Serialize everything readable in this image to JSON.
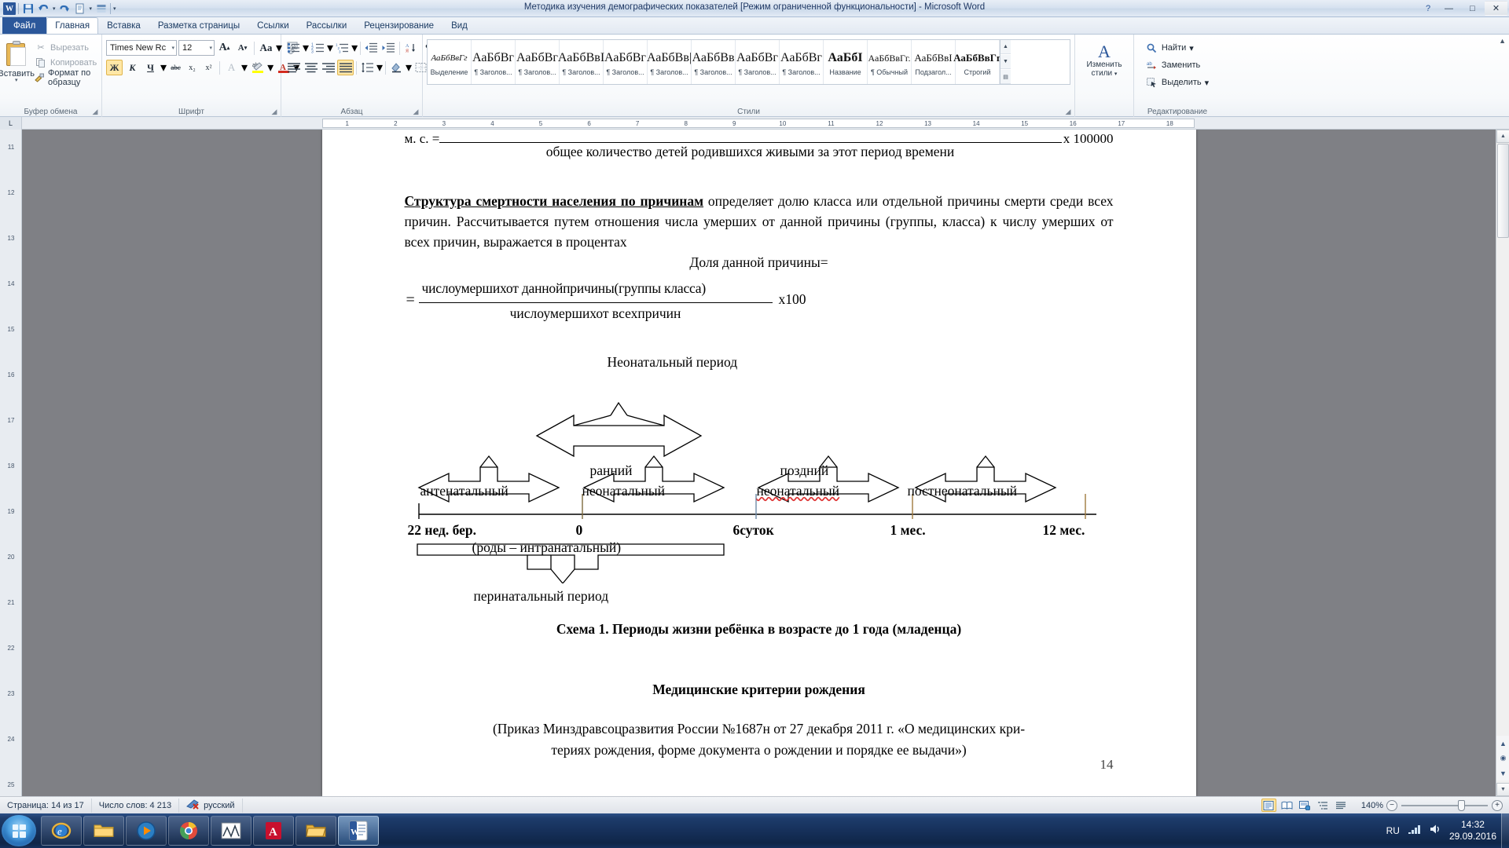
{
  "window": {
    "title": "Методика изучения демографических показателей [Режим ограниченной функциональности]  -  Microsoft Word",
    "minimize": "—",
    "maximize": "□",
    "close": "✕",
    "help": "?"
  },
  "quick_access": {
    "app_logo": "W",
    "save": "save-icon",
    "undo": "undo-icon",
    "redo": "redo-icon",
    "print_preview": "print-preview-icon",
    "customize": "customize-icon"
  },
  "tabs": [
    {
      "label": "Файл",
      "active": false,
      "kind": "file"
    },
    {
      "label": "Главная",
      "active": true
    },
    {
      "label": "Вставка",
      "active": false
    },
    {
      "label": "Разметка страницы",
      "active": false
    },
    {
      "label": "Ссылки",
      "active": false
    },
    {
      "label": "Рассылки",
      "active": false
    },
    {
      "label": "Рецензирование",
      "active": false
    },
    {
      "label": "Вид",
      "active": false
    }
  ],
  "ribbon": {
    "clipboard": {
      "group_label": "Буфер обмена",
      "paste": "Вставить",
      "cut": "Вырезать",
      "copy": "Копировать",
      "format_painter": "Формат по образцу"
    },
    "font": {
      "group_label": "Шрифт",
      "font_name": "Times New Rc",
      "font_size": "12",
      "grow_font": "A",
      "shrink_font": "A",
      "change_case": "Aa",
      "clear_formatting": "Aa",
      "bold": "Ж",
      "italic": "К",
      "underline": "Ч",
      "strikethrough": "abc",
      "subscript": "x₂",
      "superscript": "x²",
      "text_effects": "A",
      "highlight": "ab",
      "font_color": "A"
    },
    "paragraph": {
      "group_label": "Абзац",
      "bullets": "bullet-list-icon",
      "numbering": "numbered-list-icon",
      "multilevel": "multilevel-list-icon",
      "decrease_indent": "decrease-indent-icon",
      "increase_indent": "increase-indent-icon",
      "sort": "sort-icon",
      "show_marks": "¶",
      "align_left": "align-left-icon",
      "align_center": "align-center-icon",
      "align_right": "align-right-icon",
      "justify": "justify-icon",
      "line_spacing": "line-spacing-icon",
      "shading": "shading-icon",
      "borders": "borders-icon"
    },
    "styles": {
      "group_label": "Стили",
      "items": [
        {
          "sample": "АаБбВвГг",
          "name": "Выделение",
          "style": "ital"
        },
        {
          "sample": "АаБбВг",
          "name": "¶ Заголов...",
          "style": "bold"
        },
        {
          "sample": "АаБбВг",
          "name": "¶ Заголов...",
          "style": "bold"
        },
        {
          "sample": "АаБбВвI",
          "name": "¶ Заголов...",
          "style": "norm"
        },
        {
          "sample": "АаБбВг",
          "name": "¶ Заголов...",
          "style": "norm"
        },
        {
          "sample": "АаБбВв|",
          "name": "¶ Заголов...",
          "style": "norm"
        },
        {
          "sample": "АаБбВв",
          "name": "¶ Заголов...",
          "style": "norm"
        },
        {
          "sample": "АаБбВг",
          "name": "¶ Заголов...",
          "style": "norm"
        },
        {
          "sample": "АаБбВг",
          "name": "¶ Заголов...",
          "style": "norm"
        },
        {
          "sample": "АаБбІ",
          "name": "Название",
          "style": "bold"
        },
        {
          "sample": "АаБбВвГг.",
          "name": "¶ Обычный",
          "style": "norm"
        },
        {
          "sample": "АаБбВвI",
          "name": "Подзагол...",
          "style": "norm"
        },
        {
          "sample": "АаБбВвГг",
          "name": "Строгий",
          "style": "bold"
        }
      ],
      "scroll_up": "▲",
      "scroll_down": "▼",
      "more": "▤"
    },
    "change_styles": {
      "glyph": "A",
      "label": "Изменить\nстили"
    },
    "editing": {
      "group_label": "Редактирование",
      "find": "Найти",
      "replace": "Заменить",
      "select": "Выделить"
    }
  },
  "ruler": {
    "corner_tab": "L",
    "h_ticks": [
      "1",
      "2",
      "3",
      "4",
      "5",
      "6",
      "7",
      "8",
      "9",
      "10",
      "11",
      "12",
      "13",
      "14",
      "15",
      "16",
      "17",
      "18"
    ],
    "v_ticks": [
      "11",
      "12",
      "13",
      "14",
      "15",
      "16",
      "17",
      "18",
      "19",
      "20",
      "21",
      "22",
      "23",
      "24",
      "25"
    ]
  },
  "document": {
    "top_formula": {
      "lhs": "м. с. =",
      "denominator": "общее количество детей родившихся  живыми за этот период времени",
      "multiplier": "х 100000"
    },
    "paragraph": {
      "bold_lead": "Структура смертности населения по причинам",
      "rest": " определяет долю класса или отдельной причины смерти среди всех причин. Рассчитывается путем отношения числа умерших от данной причины (группы, класса) к числу умерших от всех причин, выражается в процентах"
    },
    "fraction_title": "Доля данной причины=",
    "fraction": {
      "equals": "=",
      "numerator": "числоумершихот даннойпричины(группы класса)",
      "denominator": "числоумершихот всехпричин",
      "multiplier": "х100"
    },
    "schema": {
      "neonatal_title": "Неонатальный период",
      "early": "ранний",
      "late": "поздний",
      "period_labels": [
        "антенатальный",
        "неонатальный",
        "неонатальный",
        "постнеонатальный"
      ],
      "axis_labels": [
        "22 нед. бер.",
        "0",
        "6суток",
        "1 мес.",
        "12 мес."
      ],
      "intranatal": "(роды – интранатальный)",
      "perinatal": "перинатальный период",
      "caption": "Схема 1.  Периоды жизни ребёнка в возрасте до 1 года (младенца)"
    },
    "heading": "Медицинские критерии рождения",
    "order_text_line1": "(Приказ Минздравсоцразвития России №1687н от 27 декабря 2011 г. «О медицинских кри-",
    "order_text_line2": "териях рождения, форме документа о рождении и порядке ее выдачи»)",
    "page_number": "14"
  },
  "status_bar": {
    "page": "Страница: 14 из 17",
    "words": "Число слов: 4 213",
    "proofing_icon": "proofing-errors-icon",
    "language": "русский",
    "views": {
      "print_layout": "print-layout-icon",
      "full_screen": "full-screen-reading-icon",
      "web_layout": "web-layout-icon",
      "outline": "outline-icon",
      "draft": "draft-icon"
    },
    "zoom": "140%",
    "zoom_out": "−",
    "zoom_in": "+"
  },
  "taskbar": {
    "start": "start-orb",
    "buttons": [
      {
        "name": "internet-explorer",
        "glyph": "e"
      },
      {
        "name": "file-explorer",
        "glyph": "📁"
      },
      {
        "name": "media-player",
        "glyph": "▶"
      },
      {
        "name": "google-chrome",
        "glyph": "◉"
      },
      {
        "name": "statistics-app",
        "glyph": "📈"
      },
      {
        "name": "adobe-reader",
        "glyph": "A"
      },
      {
        "name": "folder-window",
        "glyph": "📂"
      },
      {
        "name": "microsoft-word",
        "glyph": "W",
        "active": true
      }
    ],
    "language": "RU",
    "time": "14:32",
    "date": "29.09.2016"
  }
}
